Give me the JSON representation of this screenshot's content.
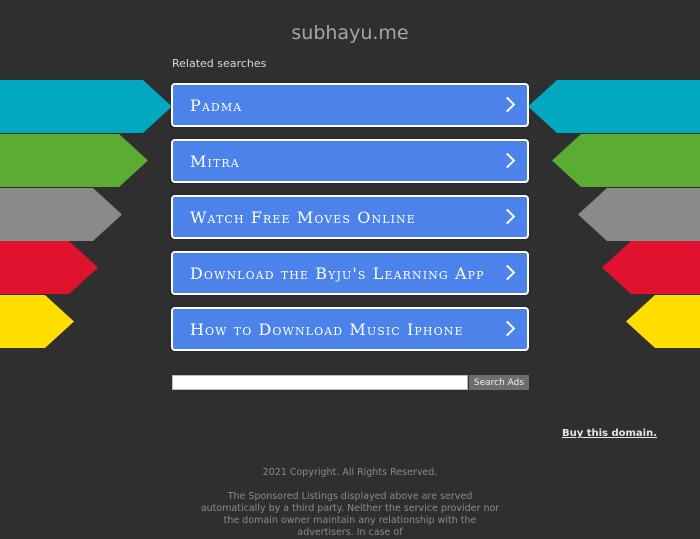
{
  "site": {
    "title": "subhayu.me",
    "related_heading": "Related searches"
  },
  "colors": {
    "background": "#2f2f2f",
    "button": "#4b83ea",
    "arrow_teal": "#00a9bf",
    "arrow_green": "#5aad32",
    "arrow_gray": "#8a8a8a",
    "arrow_red": "#e0122e",
    "arrow_yellow": "#ffde00"
  },
  "results": [
    {
      "label": "Padma",
      "icon": "chevron-right-icon"
    },
    {
      "label": "Mitra",
      "icon": "chevron-right-icon"
    },
    {
      "label": "Watch Free Moves Online",
      "icon": "chevron-right-icon"
    },
    {
      "label": "Download the Byju's Learning App",
      "icon": "chevron-right-icon"
    },
    {
      "label": "How to Download Music Iphone",
      "icon": "chevron-right-icon"
    }
  ],
  "search": {
    "value": "",
    "placeholder": "",
    "button_label": "Search Ads"
  },
  "footer": {
    "buy_link": "Buy this domain.",
    "copyright": "2021 Copyright. All Rights Reserved.",
    "disclaimer": "The Sponsored Listings displayed above are served automatically by a third party. Neither the service provider nor the domain owner maintain any relationship with the advertisers. In case of"
  }
}
